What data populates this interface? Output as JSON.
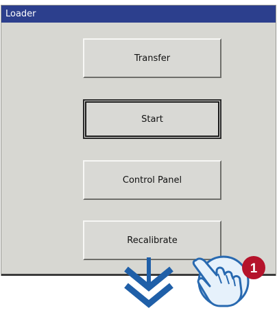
{
  "window": {
    "title": "Loader"
  },
  "buttons": [
    {
      "label": "Transfer"
    },
    {
      "label": "Start"
    },
    {
      "label": "Control Panel"
    },
    {
      "label": "Recalibrate"
    }
  ],
  "callout": {
    "number": "1"
  },
  "colors": {
    "titlebar": "#2c3f8d",
    "panel": "#d7d7d2",
    "arrow": "#1f5fa8",
    "callout": "#b5132b",
    "hand_fill": "#e6f1fb",
    "hand_stroke": "#2869b0"
  },
  "icons": {
    "scroll_arrow": "double-chevron-down-icon",
    "gesture": "touch-hand-icon"
  }
}
